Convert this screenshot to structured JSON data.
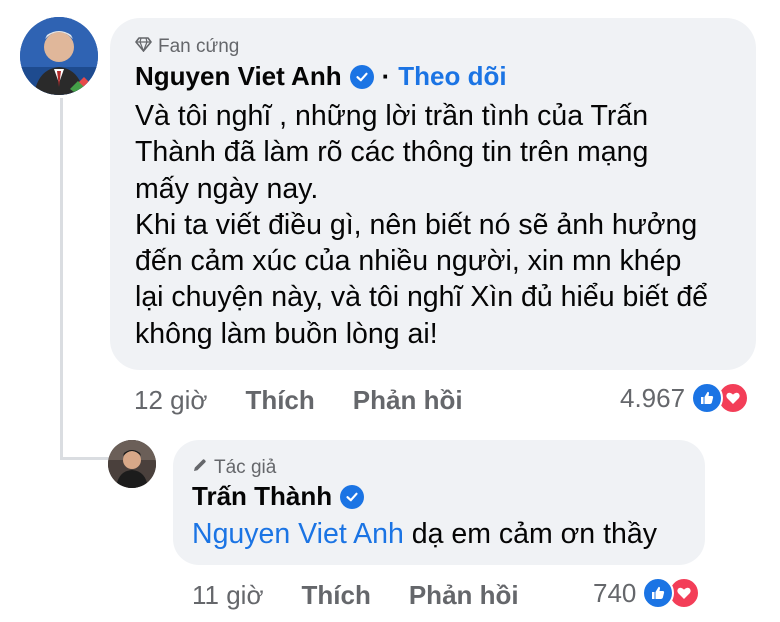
{
  "comment": {
    "badge": "Fan cứng",
    "author": "Nguyen Viet Anh",
    "follow_label": "Theo dõi",
    "text": "Và tôi nghĩ , những lời trần tình của Trấn\nThành đã làm rõ các thông tin trên mạng\nmấy ngày nay.\nKhi ta viết điều gì, nên biết nó sẽ ảnh hưởng\nđến cảm xúc của nhiều người, xin mn khép\nlại chuyện này, và tôi nghĩ Xìn đủ hiểu biết để\nkhông làm buồn lòng ai!",
    "time": "12 giờ",
    "like_label": "Thích",
    "reply_label": "Phản hồi",
    "reaction_count": "4.967"
  },
  "reply": {
    "badge": "Tác giả",
    "author": "Trấn Thành",
    "mention": "Nguyen Viet Anh",
    "text": " dạ em cảm ơn thầy",
    "time": "11 giờ",
    "like_label": "Thích",
    "reply_label": "Phản hồi",
    "reaction_count": "740"
  },
  "icons": {
    "fan_badge": "diamond-icon",
    "author_badge": "pencil-icon",
    "verified": "verified-check-icon",
    "like": "like-thumb-icon",
    "love": "heart-icon"
  },
  "colors": {
    "accent": "#1b74e4",
    "love": "#f33e58",
    "bubble": "#f0f2f5",
    "muted": "#65676b"
  }
}
